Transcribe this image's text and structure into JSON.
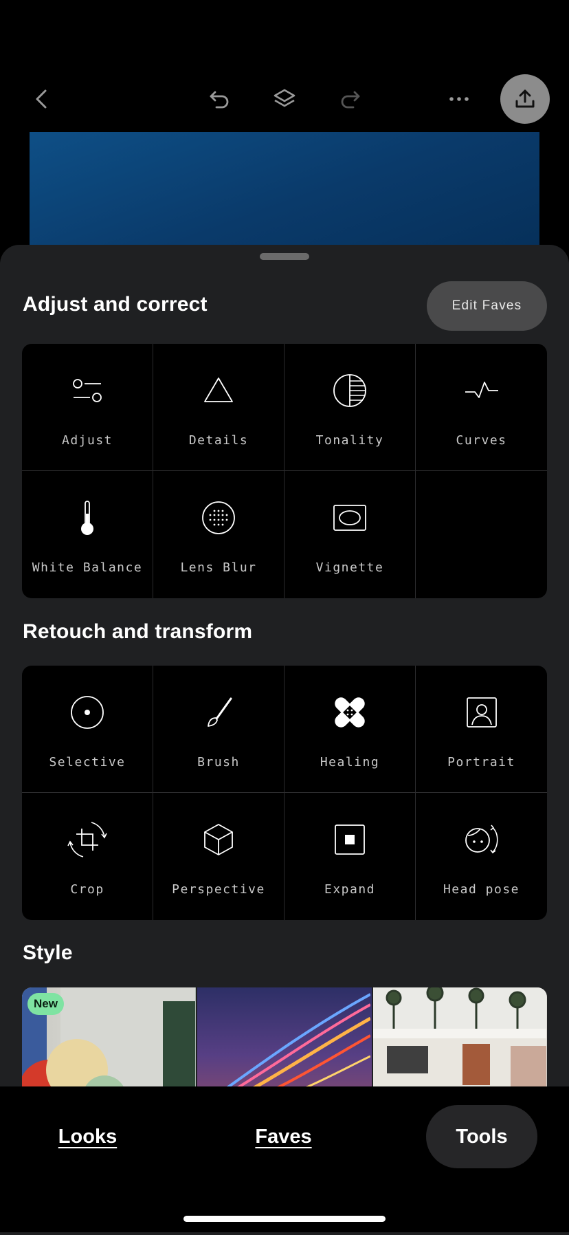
{
  "topbar": {
    "back_icon": "chevron-left-icon",
    "undo_icon": "undo-icon",
    "layers_icon": "layers-icon",
    "redo_icon": "redo-icon",
    "more_icon": "ellipsis-icon",
    "export_icon": "upload-icon"
  },
  "sheet": {
    "adjust": {
      "title": "Adjust and correct",
      "edit_faves_label": "Edit Faves",
      "tools": [
        {
          "label": "Adjust",
          "icon": "sliders-icon"
        },
        {
          "label": "Details",
          "icon": "triangle-icon"
        },
        {
          "label": "Tonality",
          "icon": "tonality-icon"
        },
        {
          "label": "Curves",
          "icon": "curves-icon"
        },
        {
          "label": "White Balance",
          "icon": "thermometer-icon"
        },
        {
          "label": "Lens Blur",
          "icon": "lens-blur-icon"
        },
        {
          "label": "Vignette",
          "icon": "vignette-icon"
        }
      ]
    },
    "retouch": {
      "title": "Retouch and transform",
      "tools": [
        {
          "label": "Selective",
          "icon": "selective-icon"
        },
        {
          "label": "Brush",
          "icon": "brush-icon"
        },
        {
          "label": "Healing",
          "icon": "bandage-icon"
        },
        {
          "label": "Portrait",
          "icon": "portrait-icon"
        },
        {
          "label": "Crop",
          "icon": "crop-rotate-icon"
        },
        {
          "label": "Perspective",
          "icon": "cube-icon"
        },
        {
          "label": "Expand",
          "icon": "expand-icon"
        },
        {
          "label": "Head pose",
          "icon": "head-pose-icon"
        }
      ]
    },
    "style": {
      "title": "Style",
      "new_badge": "New"
    }
  },
  "bottom_nav": {
    "looks": "Looks",
    "faves": "Faves",
    "tools": "Tools"
  },
  "colors": {
    "sheet_bg": "#1f2022",
    "grid_bg": "#000000",
    "new_badge_bg": "#7fe3a2",
    "export_button_bg": "#8c8c8c"
  }
}
